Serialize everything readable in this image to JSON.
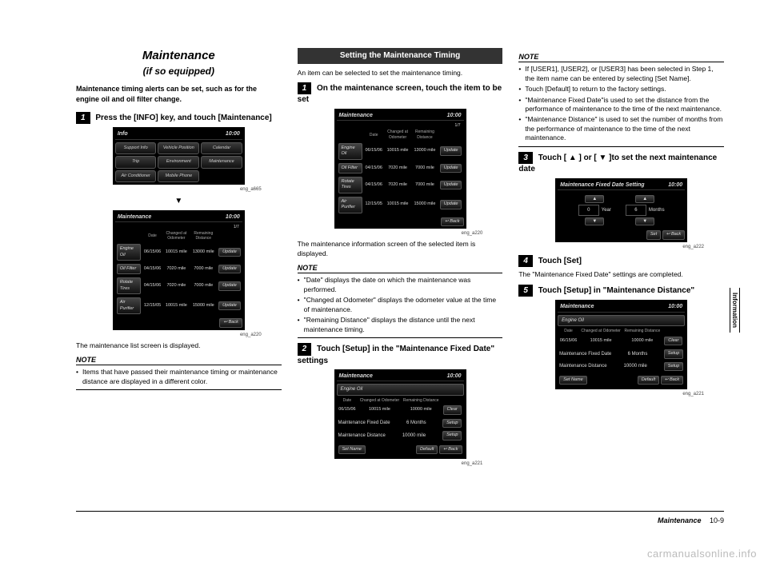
{
  "title": {
    "main": "Maintenance",
    "sub": "(if so equipped)"
  },
  "intro": "Maintenance timing alerts can be set, such as for the engine oil and oil filter change.",
  "col1": {
    "step1": "Press the [INFO] key, and touch [Maintenance]",
    "screen1": {
      "title": "Info",
      "time": "10:00",
      "buttons": [
        "Support Info",
        "Vehicle Position",
        "Calendar",
        "Trip",
        "Environment",
        "Maintenance",
        "Air Conditioner",
        "Mobile Phone"
      ],
      "caption": "eng_a665"
    },
    "screen2": {
      "title": "Maintenance",
      "time": "10:00",
      "cols": [
        "",
        "Date",
        "Changed at Odometer",
        "Remaining Distance",
        ""
      ],
      "rows": [
        [
          "Engine Oil",
          "06/15/06",
          "10015 mile",
          "13000 mile",
          "Update"
        ],
        [
          "Oil Filter",
          "04/15/06",
          "7020 mile",
          "7000 mile",
          "Update"
        ],
        [
          "Rotate Tires",
          "04/15/06",
          "7020 mile",
          "7000 mile",
          "Update"
        ],
        [
          "Air Purifier",
          "12/15/05",
          "10015 mile",
          "15000 mile",
          "Update"
        ]
      ],
      "back": "Back",
      "caption": "eng_a220",
      "page": "1/7"
    },
    "after1": "The maintenance list screen is displayed.",
    "note_head": "NOTE",
    "notes": [
      "Items that have passed their maintenance timing or maintenance distance are displayed in a different color."
    ]
  },
  "col2": {
    "header": "Setting the Maintenance Timing",
    "intro": "An item can be selected to set the maintenance timing.",
    "step1": "On the maintenance screen, touch the item to be set",
    "after1": "The maintenance information screen of the selected item is displayed.",
    "note_head": "NOTE",
    "notes": [
      "\"Date\" displays the date on which the maintenance was performed.",
      "\"Changed at Odometer\" displays the odometer value at the time of maintenance.",
      "\"Remaining Distance\" displays the distance until the next maintenance timing."
    ],
    "step2": "Touch [Setup] in the \"Maintenance Fixed Date\" settings",
    "screen3": {
      "title": "Maintenance",
      "time": "10:00",
      "item": "Engine Oil",
      "cols": [
        "Date",
        "Changed at Odometer",
        "Remaining Distance"
      ],
      "vals": [
        "06/15/06",
        "10015 mile",
        "10000 mile"
      ],
      "rows": [
        [
          "Maintenance Fixed Date",
          "6 Months",
          "Setup"
        ],
        [
          "Maintenance Distance",
          "10000 mile",
          "Setup"
        ]
      ],
      "clear": "Clear",
      "setname": "Set Name",
      "default": "Default",
      "back": "Back",
      "caption": "eng_a221"
    }
  },
  "col3": {
    "note_head": "NOTE",
    "notes": [
      "If [USER1], [USER2], or [USER3] has been selected in Step 1, the item name can be entered by selecting [Set Name].",
      "Touch [Default] to return to the factory settings.",
      "\"Maintenance Fixed Date\"is used to set the distance from the performance of maintenance to the time of the next maintenance.",
      "\"Maintenance Distance\" is used to set the number of months from the performance of maintenance to the time of the next maintenance."
    ],
    "step3": "Touch [ ▲ ] or [ ▼ ]to set the next maintenance date",
    "screen4": {
      "title": "Maintenance Fixed Date Setting",
      "time": "10:00",
      "year_label": "Year",
      "months_label": "Months",
      "year": "0",
      "months": "6",
      "set": "Set",
      "back": "Back",
      "caption": "eng_a222"
    },
    "step4": "Touch [Set]",
    "after4": "The \"Maintenance Fixed Date\" settings are completed.",
    "step5": "Touch [Setup] in \"Maintenance Distance\""
  },
  "footer": {
    "section": "Maintenance",
    "page": "10-9"
  },
  "sidetab": "Information",
  "watermark": "carmanualsonline.info"
}
